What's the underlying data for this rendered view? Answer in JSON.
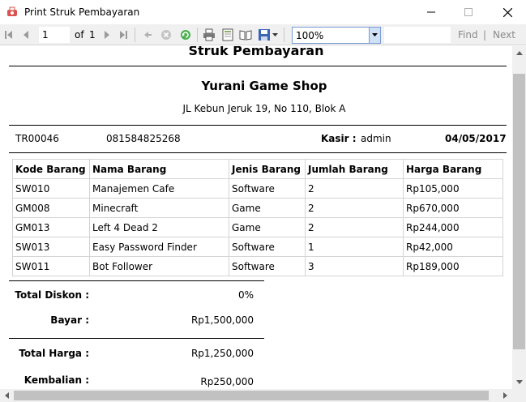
{
  "window": {
    "title": "Print Struk Pembayaran",
    "controls": {
      "minimize_icon": "minimize-icon",
      "maximize_icon": "maximize-icon",
      "close_icon": "close-icon"
    }
  },
  "toolbar": {
    "current_page": "1",
    "of_label": "of",
    "total_pages": "1",
    "zoom": "100%",
    "find_label": "Find",
    "separator": "|",
    "next_label": "Next"
  },
  "report": {
    "title": "Struk Pembayaran",
    "shop_name": "Yurani Game Shop",
    "shop_address": "JL Kebun Jeruk 19, No 110, Blok A",
    "transaction_id": "TR00046",
    "phone": "081584825268",
    "cashier_label": "Kasir :",
    "cashier": "admin",
    "date": "04/05/2017",
    "table": {
      "headers": [
        "Kode Barang",
        "Nama Barang",
        "Jenis Barang",
        "Jumlah Barang",
        "Harga Barang"
      ],
      "rows": [
        [
          "SW010",
          "Manajemen Cafe",
          "Software",
          "2",
          "Rp105,000"
        ],
        [
          "GM008",
          "Minecraft",
          "Game",
          "2",
          "Rp670,000"
        ],
        [
          "GM013",
          "Left 4 Dead 2",
          "Game",
          "2",
          "Rp244,000"
        ],
        [
          "SW013",
          "Easy Password Finder",
          "Software",
          "1",
          "Rp42,000"
        ],
        [
          "SW011",
          "Bot Follower",
          "Software",
          "3",
          "Rp189,000"
        ]
      ]
    },
    "summary": {
      "discount_label": "Total Diskon :",
      "discount": "0%",
      "paid_label": "Bayar :",
      "paid": "Rp1,500,000",
      "total_label": "Total Harga :",
      "total": "Rp1,250,000",
      "change_label": "Kembalian :",
      "change": "Rp250,000"
    }
  },
  "colors": {
    "zoom_border": "#7a9cd3",
    "scroll_thumb": "#c1c1c1",
    "toolbar_bg": "#f0f0f0",
    "app_icon": "#d9534f"
  }
}
